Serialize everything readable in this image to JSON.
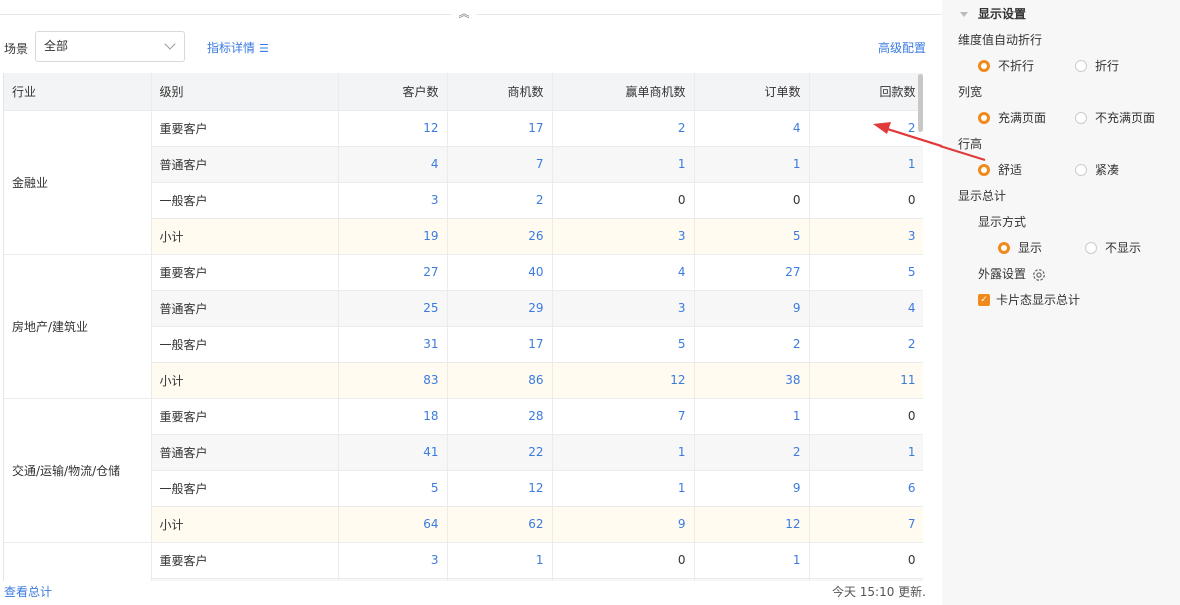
{
  "toolbar": {
    "scene_label": "场景",
    "scene_value": "全部",
    "metric_detail": "指标详情",
    "advanced_config": "高级配置"
  },
  "table": {
    "headers": [
      "行业",
      "级别",
      "客户数",
      "商机数",
      "赢单商机数",
      "订单数",
      "回款数"
    ],
    "groups": [
      {
        "industry": "金融业",
        "rows": [
          {
            "level": "重要客户",
            "values": [
              "12",
              "17",
              "2",
              "4",
              "2"
            ]
          },
          {
            "level": "普通客户",
            "values": [
              "4",
              "7",
              "1",
              "1",
              "1"
            ]
          },
          {
            "level": "一般客户",
            "values": [
              "3",
              "2",
              "0",
              "0",
              "0"
            ]
          },
          {
            "level": "小计",
            "values": [
              "19",
              "26",
              "3",
              "5",
              "3"
            ]
          }
        ]
      },
      {
        "industry": "房地产/建筑业",
        "rows": [
          {
            "level": "重要客户",
            "values": [
              "27",
              "40",
              "4",
              "27",
              "5"
            ]
          },
          {
            "level": "普通客户",
            "values": [
              "25",
              "29",
              "3",
              "9",
              "4"
            ]
          },
          {
            "level": "一般客户",
            "values": [
              "31",
              "17",
              "5",
              "2",
              "2"
            ]
          },
          {
            "level": "小计",
            "values": [
              "83",
              "86",
              "12",
              "38",
              "11"
            ]
          }
        ]
      },
      {
        "industry": "交通/运输/物流/仓储",
        "rows": [
          {
            "level": "重要客户",
            "values": [
              "18",
              "28",
              "7",
              "1",
              "0"
            ]
          },
          {
            "level": "普通客户",
            "values": [
              "41",
              "22",
              "1",
              "2",
              "1"
            ]
          },
          {
            "level": "一般客户",
            "values": [
              "5",
              "12",
              "1",
              "9",
              "6"
            ]
          },
          {
            "level": "小计",
            "values": [
              "64",
              "62",
              "9",
              "12",
              "7"
            ]
          }
        ]
      },
      {
        "industry": "",
        "rows": [
          {
            "level": "重要客户",
            "values": [
              "3",
              "1",
              "0",
              "1",
              "0"
            ]
          },
          {
            "level": "",
            "values": [
              "",
              "",
              "",
              "",
              ""
            ]
          }
        ]
      }
    ]
  },
  "footer": {
    "view_total": "查看总计",
    "updated": "今天 15:10 更新."
  },
  "panel": {
    "title": "显示设置",
    "wrap_label": "维度值自动折行",
    "wrap_opt1": "不折行",
    "wrap_opt2": "折行",
    "width_label": "列宽",
    "width_opt1": "充满页面",
    "width_opt2": "不充满页面",
    "height_label": "行高",
    "height_opt1": "舒适",
    "height_opt2": "紧凑",
    "total_label": "显示总计",
    "display_mode_label": "显示方式",
    "display_opt1": "显示",
    "display_opt2": "不显示",
    "expose_label": "外露设置",
    "card_total_label": "卡片态显示总计"
  },
  "colors": {
    "accent_orange": "#f08a1c",
    "link_blue": "#3b7be0",
    "subtotal_bg": "#fffbf0",
    "arrow_red": "#e03a3a"
  }
}
